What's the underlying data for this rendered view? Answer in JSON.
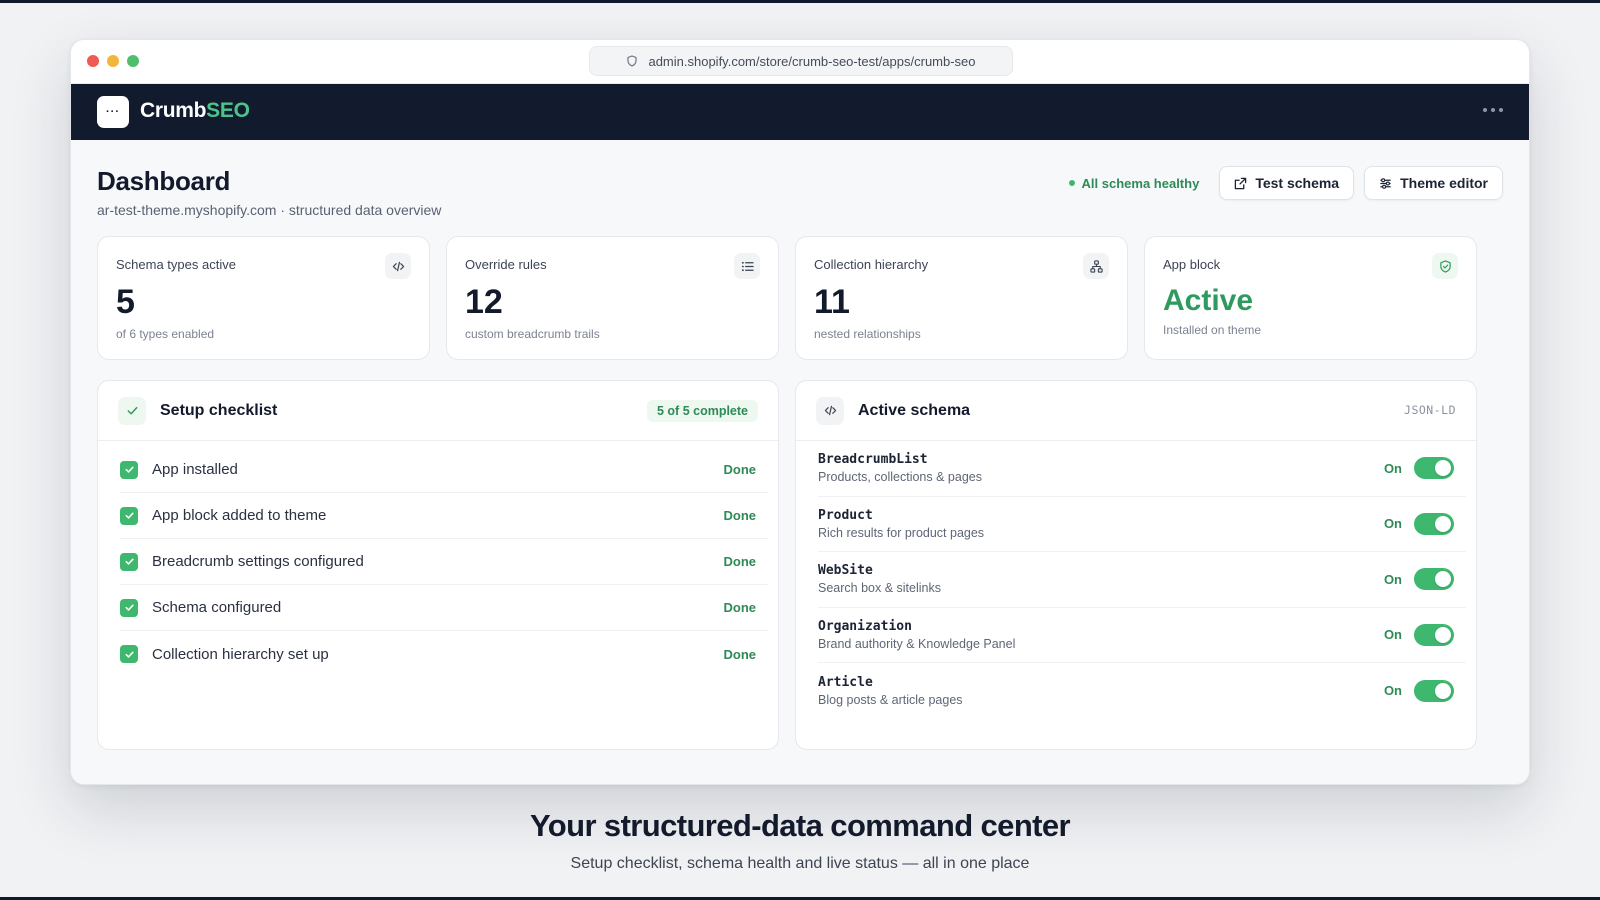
{
  "browser": {
    "url": "admin.shopify.com/store/crumb-seo-test/apps/crumb-seo"
  },
  "app": {
    "logo_text": "···",
    "brand_part1": "Crumb",
    "brand_part2": "SEO"
  },
  "header": {
    "title": "Dashboard",
    "subtitle": "ar-test-theme.myshopify.com · structured data overview",
    "health_status": "All schema healthy",
    "test_button": "Test schema",
    "theme_button": "Theme editor"
  },
  "stats": [
    {
      "label": "Schema types active",
      "value": "5",
      "sub": "of 6 types enabled"
    },
    {
      "label": "Override rules",
      "value": "12",
      "sub": "custom breadcrumb trails"
    },
    {
      "label": "Collection hierarchy",
      "value": "11",
      "sub": "nested relationships"
    },
    {
      "label": "App block",
      "value": "Active",
      "sub": "Installed on theme"
    }
  ],
  "checklist": {
    "title": "Setup checklist",
    "badge": "5 of 5 complete",
    "items": [
      {
        "label": "App installed",
        "status": "Done"
      },
      {
        "label": "App block added to theme",
        "status": "Done"
      },
      {
        "label": "Breadcrumb settings configured",
        "status": "Done"
      },
      {
        "label": "Schema configured",
        "status": "Done"
      },
      {
        "label": "Collection hierarchy set up",
        "status": "Done"
      }
    ]
  },
  "schema": {
    "title": "Active schema",
    "format": "JSON-LD",
    "items": [
      {
        "name": "BreadcrumbList",
        "desc": "Products, collections & pages",
        "state": "On"
      },
      {
        "name": "Product",
        "desc": "Rich results for product pages",
        "state": "On"
      },
      {
        "name": "WebSite",
        "desc": "Search box & sitelinks",
        "state": "On"
      },
      {
        "name": "Organization",
        "desc": "Brand authority & Knowledge Panel",
        "state": "On"
      },
      {
        "name": "Article",
        "desc": "Blog posts & article pages",
        "state": "On"
      }
    ]
  },
  "caption": {
    "title": "Your structured-data command center",
    "subtitle": "Setup checklist, schema health and live status — all in one place"
  },
  "colors": {
    "navy": "#121b2e",
    "accent_green": "#3fb86f",
    "brand_green": "#4cc38a"
  }
}
